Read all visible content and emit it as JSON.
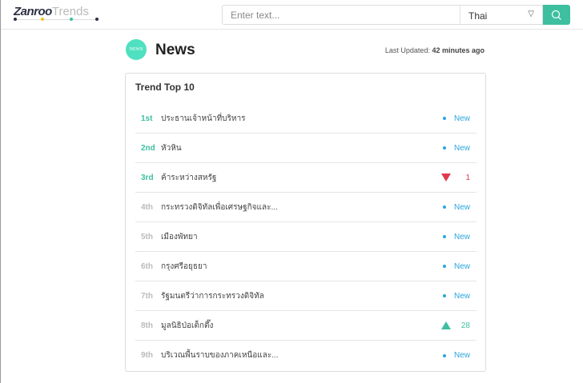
{
  "header": {
    "logo_brand": "Zanroo",
    "logo_product": "Trends",
    "search_placeholder": "Enter text...",
    "language": "Thai",
    "search_icon": "search-icon"
  },
  "page": {
    "title": "News",
    "icon_label": "NEWS",
    "updated_label": "Last Updated:",
    "updated_value": "42 minutes ago"
  },
  "card": {
    "title": "Trend Top 10",
    "rows": [
      {
        "rank": "1st",
        "keyword": "ประธานเจ้าหน้าที่บริหาร",
        "status": "New"
      },
      {
        "rank": "2nd",
        "keyword": "หัวหิน",
        "status": "New"
      },
      {
        "rank": "3rd",
        "keyword": "ค้าระหว่างสหรัฐ",
        "status": "down",
        "change": "1"
      },
      {
        "rank": "4th",
        "keyword": "กระทรวงดิจิทัลเพื่อเศรษฐกิจและ...",
        "status": "New"
      },
      {
        "rank": "5th",
        "keyword": "เมืองพัทยา",
        "status": "New"
      },
      {
        "rank": "6th",
        "keyword": "กรุงศรีอยุธยา",
        "status": "New"
      },
      {
        "rank": "7th",
        "keyword": "รัฐมนตรีว่าการกระทรวงดิจิทัล",
        "status": "New"
      },
      {
        "rank": "8th",
        "keyword": "มูลนิธิป่อเต็กตึ๊ง",
        "status": "up",
        "change": "28"
      },
      {
        "rank": "9th",
        "keyword": "บริเวณพื้นราบของภาคเหนือและ...",
        "status": "New"
      }
    ]
  },
  "colors": {
    "accent": "#3dbfa0",
    "new": "#2ba6de",
    "down": "#e03a4c"
  }
}
